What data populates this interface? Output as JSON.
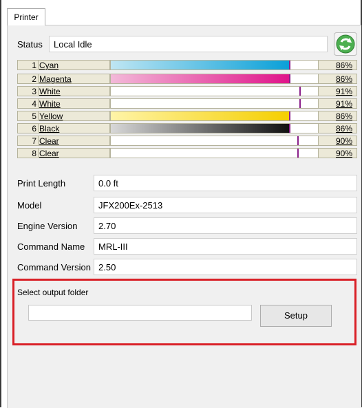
{
  "tab": {
    "label": "Printer"
  },
  "status": {
    "label": "Status",
    "value": "Local Idle"
  },
  "inks": [
    {
      "index": "1",
      "name": "Cyan",
      "percent": "86%",
      "level": 0.86,
      "color_from": "#bfe6f3",
      "color_to": "#0aa0d8"
    },
    {
      "index": "2",
      "name": "Magenta",
      "percent": "86%",
      "level": 0.86,
      "color_from": "#f3b9d9",
      "color_to": "#e0148a"
    },
    {
      "index": "3",
      "name": "White",
      "percent": "91%",
      "level": 0.91,
      "color_from": "#ffffff",
      "color_to": "#ffffff"
    },
    {
      "index": "4",
      "name": "White",
      "percent": "91%",
      "level": 0.91,
      "color_from": "#ffffff",
      "color_to": "#ffffff"
    },
    {
      "index": "5",
      "name": "Yellow",
      "percent": "86%",
      "level": 0.86,
      "color_from": "#fff4a8",
      "color_to": "#f5cf00"
    },
    {
      "index": "6",
      "name": "Black",
      "percent": "86%",
      "level": 0.86,
      "color_from": "#d8d8d8",
      "color_to": "#111111"
    },
    {
      "index": "7",
      "name": "Clear",
      "percent": "90%",
      "level": 0.9,
      "color_from": "#ffffff",
      "color_to": "#ffffff"
    },
    {
      "index": "8",
      "name": "Clear",
      "percent": "90%",
      "level": 0.9,
      "color_from": "#ffffff",
      "color_to": "#ffffff"
    }
  ],
  "info": [
    {
      "label": "Print Length",
      "value": "0.0 ft"
    },
    {
      "label": "Model",
      "value": "JFX200Ex-2513"
    },
    {
      "label": "Engine Version",
      "value": "2.70"
    },
    {
      "label": "Command Name",
      "value": "MRL-III"
    },
    {
      "label": "Command Version",
      "value": "2.50"
    }
  ],
  "output": {
    "label": "Select output folder",
    "folder_value": "",
    "setup_label": "Setup"
  },
  "colors": {
    "highlight_border": "#d91f26",
    "refresh_icon": "#4caf50"
  }
}
